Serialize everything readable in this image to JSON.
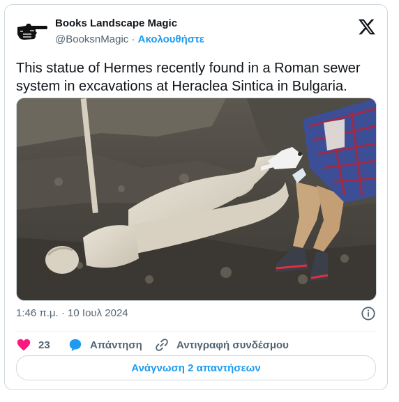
{
  "author": {
    "display_name": "Books Landscape Magic",
    "handle": "@BooksnMagic",
    "separator": " · ",
    "follow_label": "Ακολουθήστε"
  },
  "tweet": {
    "text": "This statue of Hermes recently found in a Roman sewer system in excavations at Heraclea Sintica in Bulgaria.",
    "media_description": "Marble statue of Hermes lying in excavated earth with an archaeologist pointing at it",
    "time": "1:46 π.μ.",
    "date_separator": " · ",
    "date": "10 Ιουλ 2024"
  },
  "actions": {
    "like_count": "23",
    "reply_label": "Απάντηση",
    "copy_link_label": "Αντιγραφή συνδέσμου"
  },
  "read_replies_label": "Ανάγνωση 2 απαντήσεων",
  "colors": {
    "accent": "#1d9bf0",
    "like": "#f91880",
    "reply_bubble": "#1d9bf0",
    "muted": "#536471",
    "border": "#cfd9de"
  },
  "icons": [
    "pointing-hand-icon",
    "x-logo-icon",
    "info-icon",
    "heart-icon",
    "reply-bubble-icon",
    "link-icon"
  ]
}
